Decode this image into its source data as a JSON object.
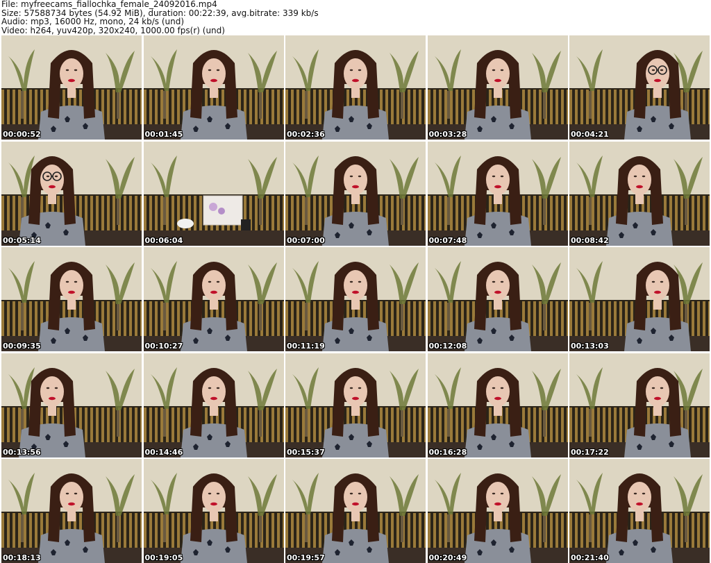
{
  "header": {
    "file_line": "File: myfreecams_fiallochka_female_24092016.mp4",
    "size_line": "Size: 57588734 bytes (54.92 MiB), duration: 00:22:39, avg.bitrate: 339 kb/s",
    "audio_line": "Audio: mp3, 16000 Hz, mono, 24 kb/s (und)",
    "video_line": "Video: h264, yuv420p, 320x240, 1000.00 fps(r) (und)"
  },
  "colors": {
    "wall": "#ddd6c2",
    "stripe_dark": "#2b2418",
    "stripe_gold": "#9a7a3a",
    "floor": "#3a2e26",
    "hair": "#3a1f14",
    "skin": "#e8c7b3",
    "sweater": "#8a8f99",
    "lips": "#c0102a"
  },
  "thumbnails": [
    {
      "time": "00:00:52",
      "glasses": false,
      "pose": "center"
    },
    {
      "time": "00:01:45",
      "glasses": false,
      "pose": "center"
    },
    {
      "time": "00:02:36",
      "glasses": false,
      "pose": "center"
    },
    {
      "time": "00:03:28",
      "glasses": false,
      "pose": "center"
    },
    {
      "time": "00:04:21",
      "glasses": true,
      "pose": "right"
    },
    {
      "time": "00:05:14",
      "glasses": true,
      "pose": "left"
    },
    {
      "time": "00:06:04",
      "glasses": false,
      "pose": "empty"
    },
    {
      "time": "00:07:00",
      "glasses": false,
      "pose": "center"
    },
    {
      "time": "00:07:48",
      "glasses": false,
      "pose": "center"
    },
    {
      "time": "00:08:42",
      "glasses": false,
      "pose": "center"
    },
    {
      "time": "00:09:35",
      "glasses": false,
      "pose": "center"
    },
    {
      "time": "00:10:27",
      "glasses": false,
      "pose": "center"
    },
    {
      "time": "00:11:19",
      "glasses": false,
      "pose": "center"
    },
    {
      "time": "00:12:08",
      "glasses": false,
      "pose": "center"
    },
    {
      "time": "00:13:03",
      "glasses": false,
      "pose": "right"
    },
    {
      "time": "00:13:56",
      "glasses": false,
      "pose": "left"
    },
    {
      "time": "00:14:46",
      "glasses": false,
      "pose": "center"
    },
    {
      "time": "00:15:37",
      "glasses": false,
      "pose": "center"
    },
    {
      "time": "00:16:28",
      "glasses": false,
      "pose": "center"
    },
    {
      "time": "00:17:22",
      "glasses": false,
      "pose": "right"
    },
    {
      "time": "00:18:13",
      "glasses": false,
      "pose": "center"
    },
    {
      "time": "00:19:05",
      "glasses": false,
      "pose": "center"
    },
    {
      "time": "00:19:57",
      "glasses": false,
      "pose": "center"
    },
    {
      "time": "00:20:49",
      "glasses": false,
      "pose": "center"
    },
    {
      "time": "00:21:40",
      "glasses": false,
      "pose": "center"
    }
  ]
}
